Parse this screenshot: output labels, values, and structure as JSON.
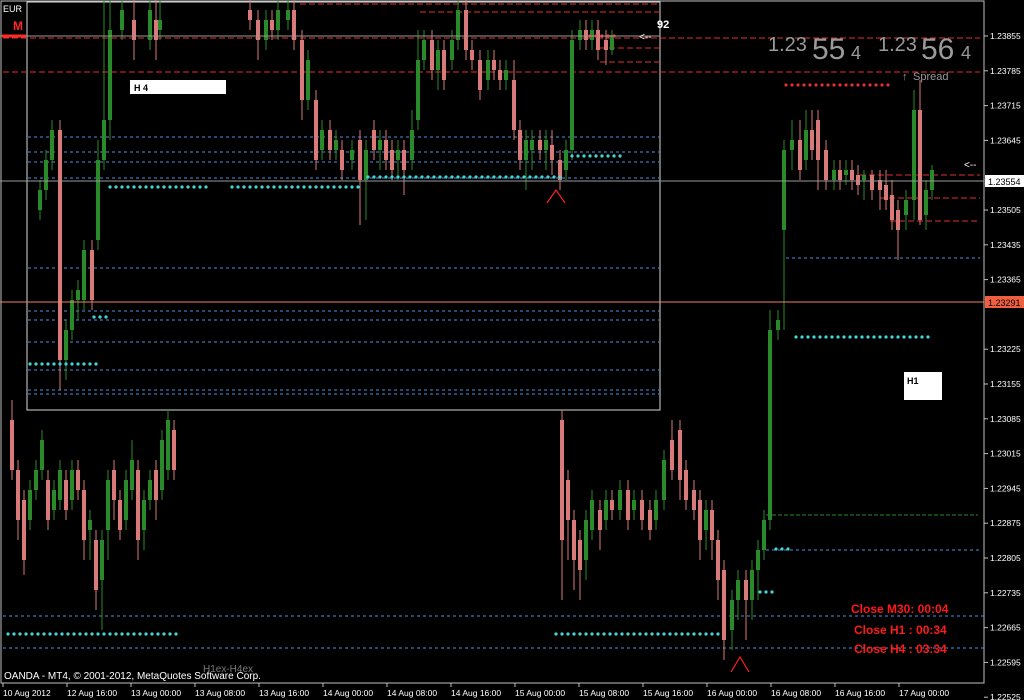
{
  "window": {
    "symbol": "EUR",
    "mode_badge": "M",
    "footer": "OANDA - MT4, © 2001-2012, MetaQuotes Software Corp.",
    "footer_label": "H1ex-H4ex"
  },
  "labels": {
    "h4": "H 4",
    "h1": "H1",
    "spread_marker": "92",
    "spread": "Spread"
  },
  "quotes": {
    "bid_prefix": "1.23",
    "bid_big": "55",
    "bid_small": "4",
    "ask_prefix": "1.23",
    "ask_big": "56",
    "ask_small": "4"
  },
  "close_timers": [
    "Close M30: 00:04",
    "Close H1 :  00:34",
    "Close H4 :  03:34"
  ],
  "colors": {
    "bull": "#2a8a2a",
    "bear": "#d87a7a",
    "cyan": "#3fd9d9",
    "blue_dash": "#4e8fe0",
    "red_dash": "#e03030",
    "timer_red": "#ff1a1a",
    "grid": "#ffffff",
    "salmon": "#f08060"
  },
  "chart_data": {
    "type": "candlestick",
    "y_ticks": [
      "1.23855",
      "1.23785",
      "1.23715",
      "1.23645",
      "1.23554",
      "1.23505",
      "1.23435",
      "1.23365",
      "1.23291",
      "1.23225",
      "1.23155",
      "1.23085",
      "1.23015",
      "1.22945",
      "1.22875",
      "1.22805",
      "1.22735",
      "1.22665",
      "1.22595",
      "1.22525"
    ],
    "current_price_label": "1.23554",
    "line_price_label": "1.23291",
    "x_ticks": [
      "10 Aug 2012",
      "12 Aug 16:00",
      "13 Aug 00:00",
      "13 Aug 08:00",
      "13 Aug 16:00",
      "14 Aug 00:00",
      "14 Aug 08:00",
      "14 Aug 16:00",
      "15 Aug 00:00",
      "15 Aug 08:00",
      "15 Aug 16:00",
      "16 Aug 00:00",
      "16 Aug 08:00",
      "16 Aug 16:00",
      "17 Aug 00:00"
    ]
  }
}
